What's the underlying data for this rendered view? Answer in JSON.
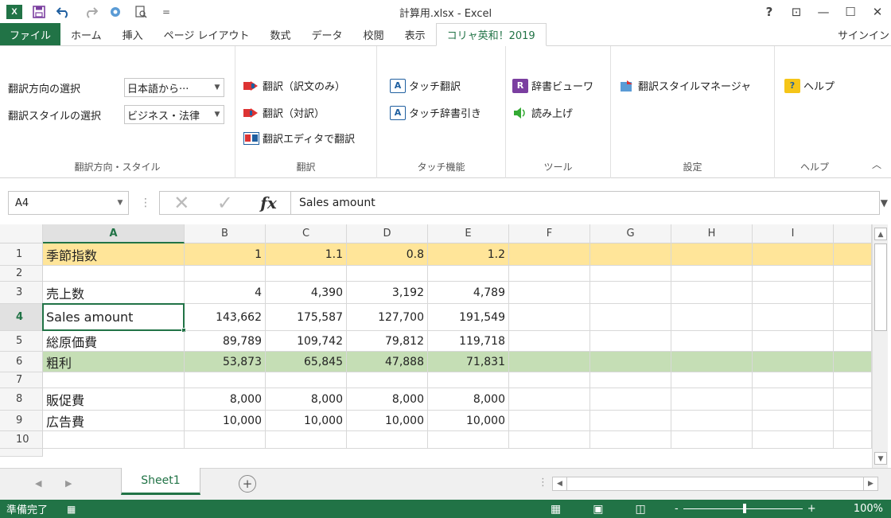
{
  "titlebar": {
    "title": "計算用.xlsx - Excel",
    "help": "?",
    "restore_ribbon": "⊡",
    "minimize": "—",
    "maximize": "☐",
    "close": "✕"
  },
  "tabs": [
    "ファイル",
    "ホーム",
    "挿入",
    "ページ レイアウト",
    "数式",
    "データ",
    "校閲",
    "表示",
    "コリャ英和！2019"
  ],
  "active_tab": "コリャ英和！2019",
  "signin": "サインイン",
  "ribbon": {
    "g1": {
      "direction_label": "翻訳方向の選択",
      "direction_value": "日本語から···",
      "style_label": "翻訳スタイルの選択",
      "style_value": "ビジネス・法律",
      "group_label": "翻訳方向・スタイル"
    },
    "g2": {
      "translate_only": "翻訳（訳文のみ）",
      "translate_pair": "翻訳（対訳）",
      "translate_editor": "翻訳エディタで翻訳",
      "group_label": "翻訳"
    },
    "g3": {
      "touch_translate": "タッチ翻訳",
      "touch_dict": "タッチ辞書引き",
      "group_label": "タッチ機能"
    },
    "g4": {
      "dict_viewer": "辞書ビューワ",
      "read_aloud": "読み上げ",
      "group_label": "ツール"
    },
    "g5": {
      "style_manager": "翻訳スタイルマネージャ",
      "group_label": "設定"
    },
    "g6": {
      "help": "ヘルプ",
      "group_label": "ヘルプ"
    }
  },
  "formula_bar": {
    "name_box": "A4",
    "fx": "fx",
    "formula": "Sales amount"
  },
  "columns": [
    "A",
    "B",
    "C",
    "D",
    "E",
    "F",
    "G",
    "H",
    "I"
  ],
  "selected_column": "A",
  "rows": [
    {
      "n": "1",
      "cells": [
        "季節指数",
        "1",
        "1.1",
        "0.8",
        "1.2"
      ],
      "fill": "yellow"
    },
    {
      "n": "2",
      "cells": [
        "",
        "",
        "",
        "",
        ""
      ],
      "fill": ""
    },
    {
      "n": "3",
      "cells": [
        "売上数",
        "4",
        "4,390",
        "3,192",
        "4,789"
      ],
      "fill": ""
    },
    {
      "n": "4",
      "cells": [
        "Sales amount",
        "143,662",
        "175,587",
        "127,700",
        "191,549"
      ],
      "fill": ""
    },
    {
      "n": "5",
      "cells": [
        "総原価費",
        "89,789",
        "109,742",
        "79,812",
        "119,718"
      ],
      "fill": ""
    },
    {
      "n": "6",
      "cells": [
        "粗利",
        "53,873",
        "65,845",
        "47,888",
        "71,831"
      ],
      "fill": "green"
    },
    {
      "n": "7",
      "cells": [
        "",
        "",
        "",
        "",
        ""
      ],
      "fill": ""
    },
    {
      "n": "8",
      "cells": [
        "販促費",
        "8,000",
        "8,000",
        "8,000",
        "8,000"
      ],
      "fill": ""
    },
    {
      "n": "9",
      "cells": [
        "広告費",
        "10,000",
        "10,000",
        "10,000",
        "10,000"
      ],
      "fill": ""
    },
    {
      "n": "10",
      "cells": [
        "",
        "",
        "",
        "",
        ""
      ],
      "fill": ""
    }
  ],
  "active_row": "4",
  "sheet": {
    "name": "Sheet1",
    "add": "+"
  },
  "status": {
    "ready": "準備完了",
    "zoom": "100%",
    "minus": "-",
    "plus": "+"
  },
  "colors": {
    "excel_green": "#217346",
    "row1_fill": "#ffe599",
    "row6_fill": "#c5deb5"
  }
}
